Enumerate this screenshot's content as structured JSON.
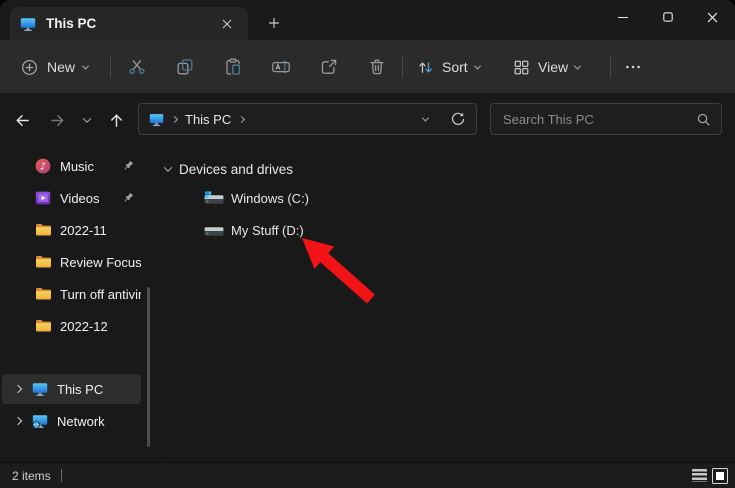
{
  "window": {
    "tab_title": "This PC"
  },
  "toolbar": {
    "new_label": "New",
    "sort_label": "Sort",
    "view_label": "View",
    "more_label": "…"
  },
  "address_bar": {
    "location": "This PC",
    "search_placeholder": "Search This PC"
  },
  "sidebar": {
    "items": [
      {
        "label": "Music",
        "icon": "music-icon",
        "pinned": true
      },
      {
        "label": "Videos",
        "icon": "videos-icon",
        "pinned": true
      },
      {
        "label": "2022-11",
        "icon": "folder-icon",
        "pinned": false
      },
      {
        "label": "Review Focus W",
        "icon": "folder-icon",
        "pinned": false
      },
      {
        "label": "Turn off antiviru",
        "icon": "folder-icon",
        "pinned": false
      },
      {
        "label": "2022-12",
        "icon": "folder-icon",
        "pinned": false
      }
    ],
    "tree_items": [
      {
        "label": "This PC",
        "icon": "this-pc-icon",
        "selected": true
      },
      {
        "label": "Network",
        "icon": "network-icon",
        "selected": false
      }
    ]
  },
  "content": {
    "group_header": "Devices and drives",
    "drives": [
      {
        "label": "Windows (C:)",
        "type": "system-drive"
      },
      {
        "label": "My Stuff (D:)",
        "type": "data-drive"
      }
    ],
    "annotation": {
      "shape": "red-arrow",
      "color": "#F21317",
      "points_at": "My Stuff (D:)"
    }
  },
  "status_bar": {
    "item_count": "2 items"
  },
  "colors": {
    "window_bg": "#191919",
    "tab_bar_bg": "#1A1A1A",
    "command_bar_bg": "#2B2B2B",
    "selected_item_bg": "#2D2D2D",
    "accent_blue_icons": "#4C7E9E",
    "folder_yellow": "#FFD15E",
    "arrow_red": "#F21317"
  }
}
